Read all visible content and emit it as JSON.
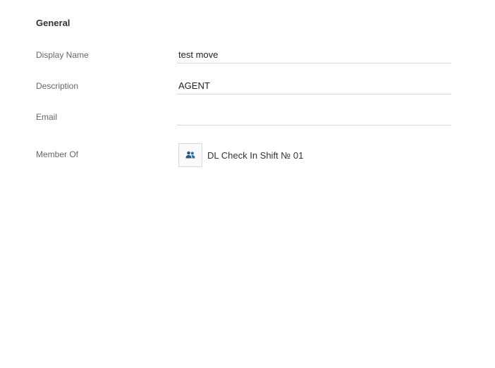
{
  "general": {
    "section_title": "General",
    "fields": {
      "display_name": {
        "label": "Display Name",
        "value": "test move",
        "placeholder": ""
      },
      "description": {
        "label": "Description",
        "value": "AGENT",
        "placeholder": ""
      },
      "email": {
        "label": "Email",
        "value": "",
        "placeholder": ""
      }
    },
    "member_of": {
      "label": "Member Of",
      "groups": [
        {
          "name": "DL Check In Shift № 01",
          "icon": "group-icon"
        }
      ]
    }
  },
  "colors": {
    "group_icon": "#1f5b8c",
    "divider": "#d6d6d6"
  }
}
